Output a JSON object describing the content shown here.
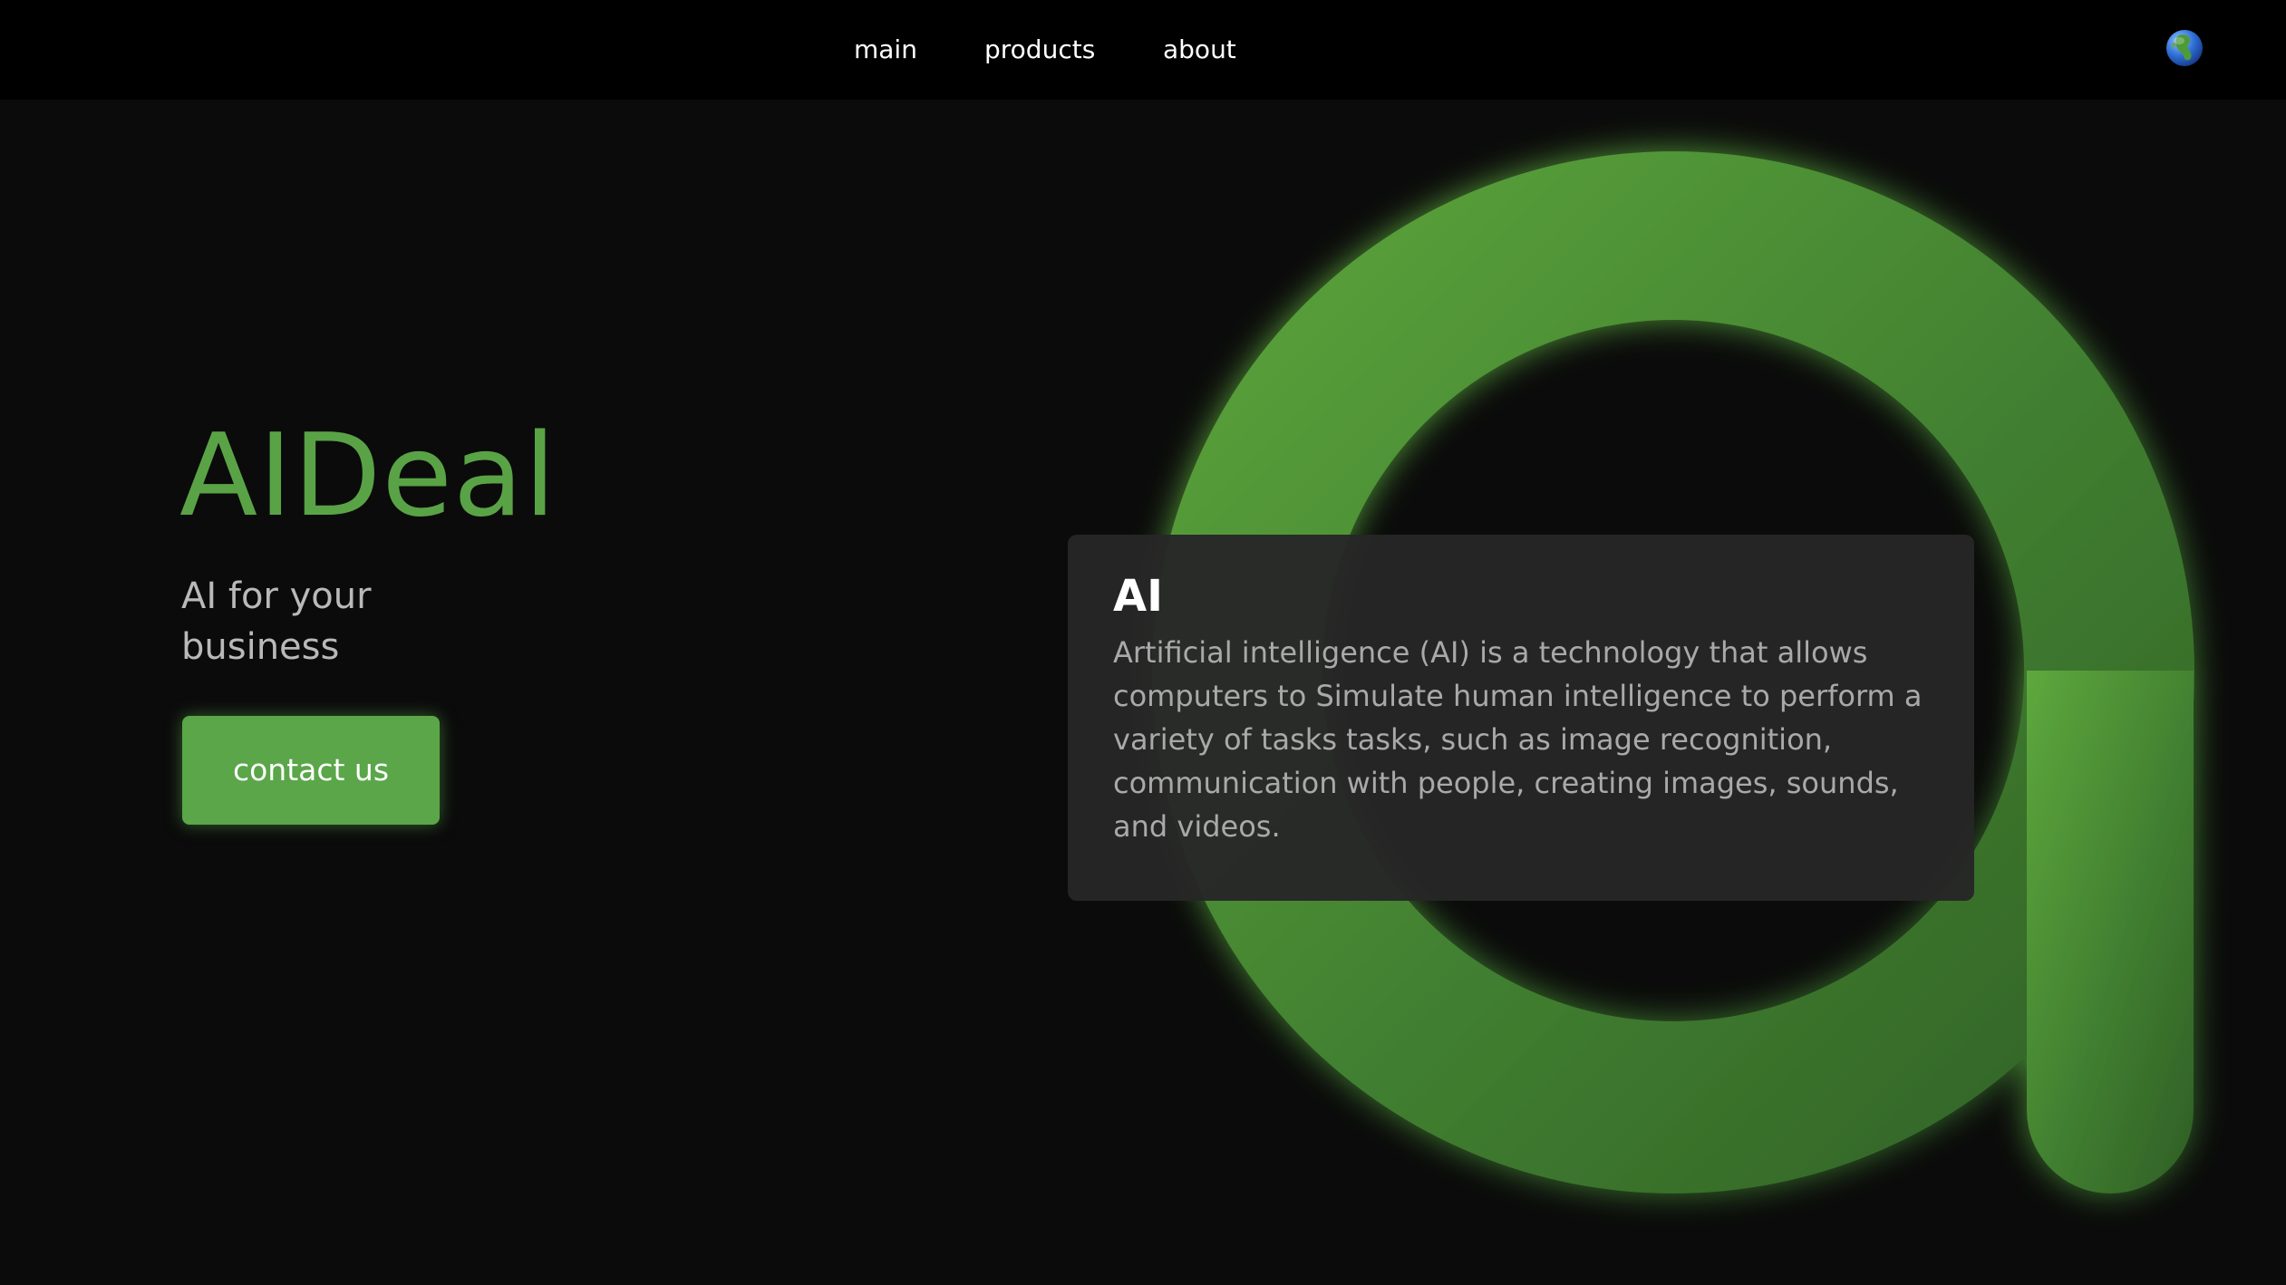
{
  "nav": {
    "items": [
      {
        "label": "main"
      },
      {
        "label": "products"
      },
      {
        "label": "about"
      }
    ],
    "language_icon": "globe-icon"
  },
  "hero": {
    "title": "AIDeal",
    "subtitle": "AI for your business",
    "cta_label": "contact us"
  },
  "info_card": {
    "title": "AI",
    "text": "Artificial intelligence (AI) is a technology that allows computers to Simulate human intelligence to perform a variety of tasks tasks, such as image recognition, communication with people, creating images, sounds, and videos."
  },
  "colors": {
    "background": "#0b0b0b",
    "topbar": "#000000",
    "accent_green": "#59a346",
    "card_bg": "#262626",
    "subtitle_text": "#b9b9b9"
  }
}
